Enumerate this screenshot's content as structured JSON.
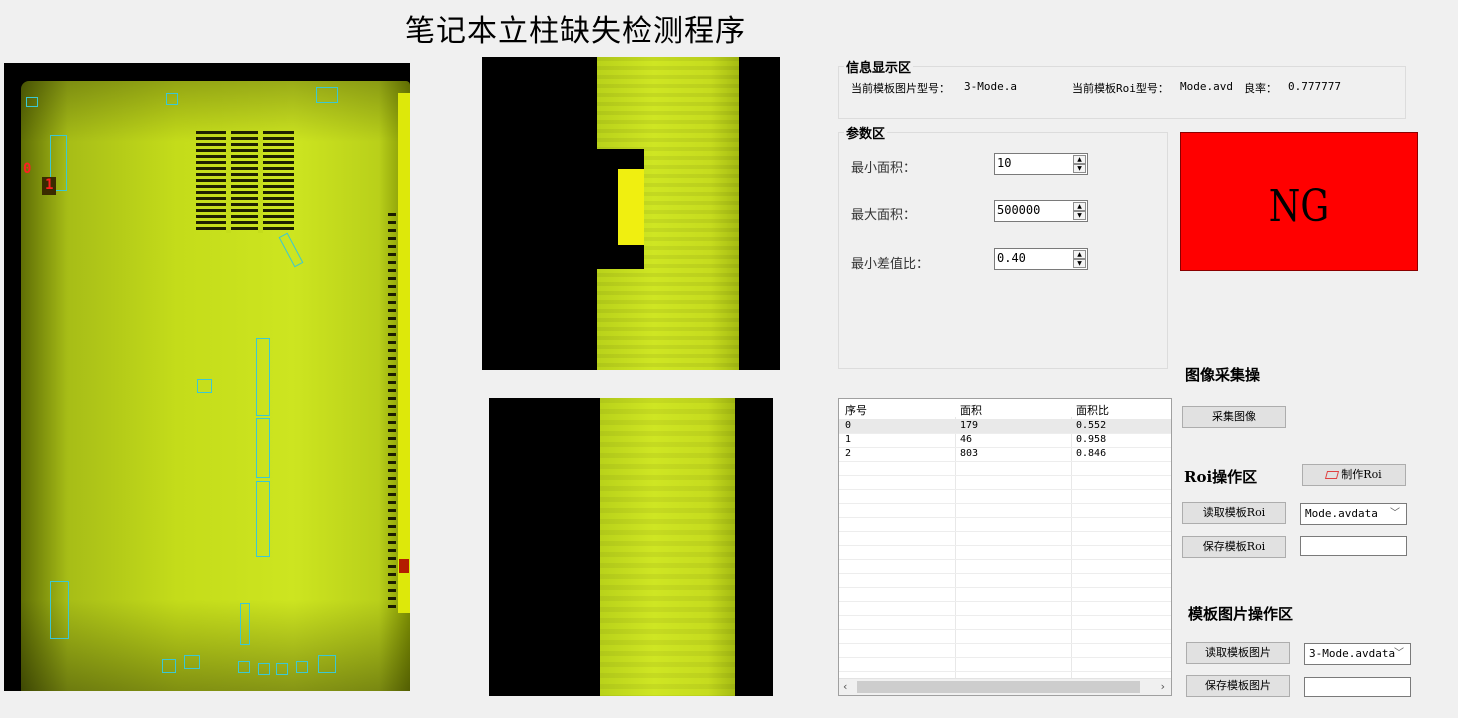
{
  "app": {
    "title": "笔记本立柱缺失检测程序"
  },
  "main_image": {
    "marks": [
      "0",
      "1"
    ]
  },
  "info": {
    "group_title": "信息显示区",
    "template_image_label": "当前模板图片型号：",
    "template_image_value": "3-Mode.a",
    "template_roi_label": "当前模板Roi型号：",
    "template_roi_value": "Mode.avd",
    "yield_label": "良率：",
    "yield_value": "0.777777"
  },
  "params": {
    "group_title": "参数区",
    "min_area_label": "最小面积：",
    "min_area_value": "10",
    "max_area_label": "最大面积：",
    "max_area_value": "500000",
    "min_diff_label": "最小差值比：",
    "min_diff_value": "0.40"
  },
  "result": {
    "text": "NG",
    "color": "#ff0000"
  },
  "table": {
    "headers": [
      "序号",
      "面积",
      "面积比"
    ],
    "rows": [
      [
        "0",
        "179",
        "0.552"
      ],
      [
        "1",
        "46",
        "0.958"
      ],
      [
        "2",
        "803",
        "0.846"
      ]
    ]
  },
  "capture": {
    "section_title": "图像采集操",
    "capture_button": "采集图像"
  },
  "roi": {
    "section_title": "Roi操作区",
    "make_button": "制作Roi",
    "read_button": "读取模板Roi",
    "save_button": "保存模板Roi",
    "combo_value": "Mode.avdata",
    "save_name": ""
  },
  "template": {
    "section_title": "模板图片操作区",
    "read_button": "读取模板图片",
    "save_button": "保存模板图片",
    "combo_value": "3-Mode.avdata",
    "save_name": ""
  },
  "icons": [
    "spin-up-icon",
    "spin-down-icon",
    "chevron-down-icon",
    "roi-shape-icon",
    "scroll-left-icon",
    "scroll-right-icon"
  ]
}
